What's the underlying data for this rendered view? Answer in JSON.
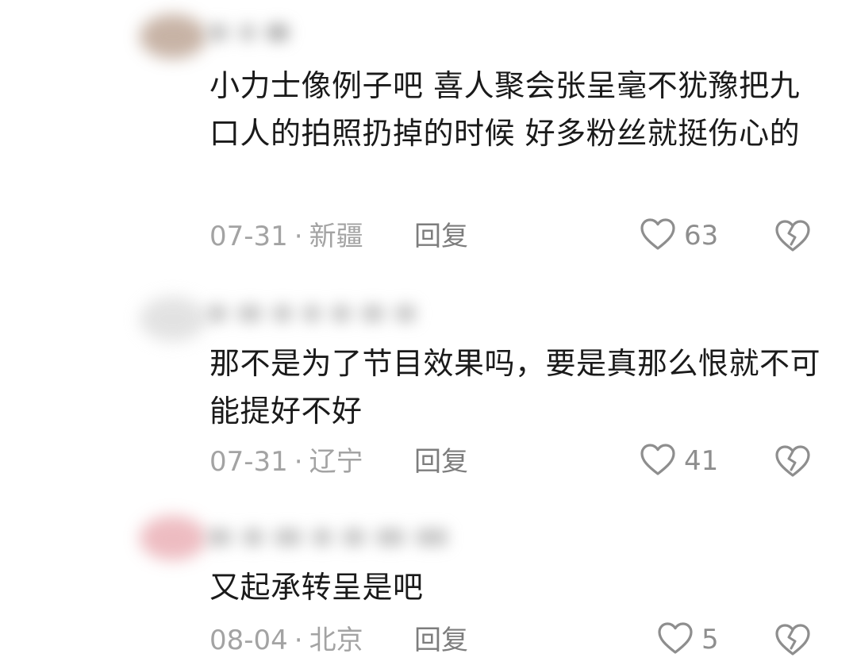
{
  "comments": [
    {
      "text": "小力士像例子吧  喜人聚会张呈毫不犹豫把九口人的拍照扔掉的时候 好多粉丝就挺伤心的",
      "date": "07-31",
      "location": "新疆",
      "reply_label": "回复",
      "like_count": "63",
      "avatar_color": "#b59a88"
    },
    {
      "text": "那不是为了节目效果吗，要是真那么恨就不可能提好不好",
      "date": "07-31",
      "location": "辽宁",
      "reply_label": "回复",
      "like_count": "41",
      "avatar_color": "#d9d9d9"
    },
    {
      "text": "又起承转呈是吧",
      "date": "08-04",
      "location": "北京",
      "reply_label": "回复",
      "like_count": "5",
      "avatar_color": "#e8a6ad"
    }
  ],
  "meta_separator": "·",
  "icons": {
    "like": "heart-outline-icon",
    "dislike": "broken-heart-icon"
  },
  "colors": {
    "text": "#1a1a1a",
    "meta": "#a3a3a3",
    "icon": "#8e8e8e"
  }
}
